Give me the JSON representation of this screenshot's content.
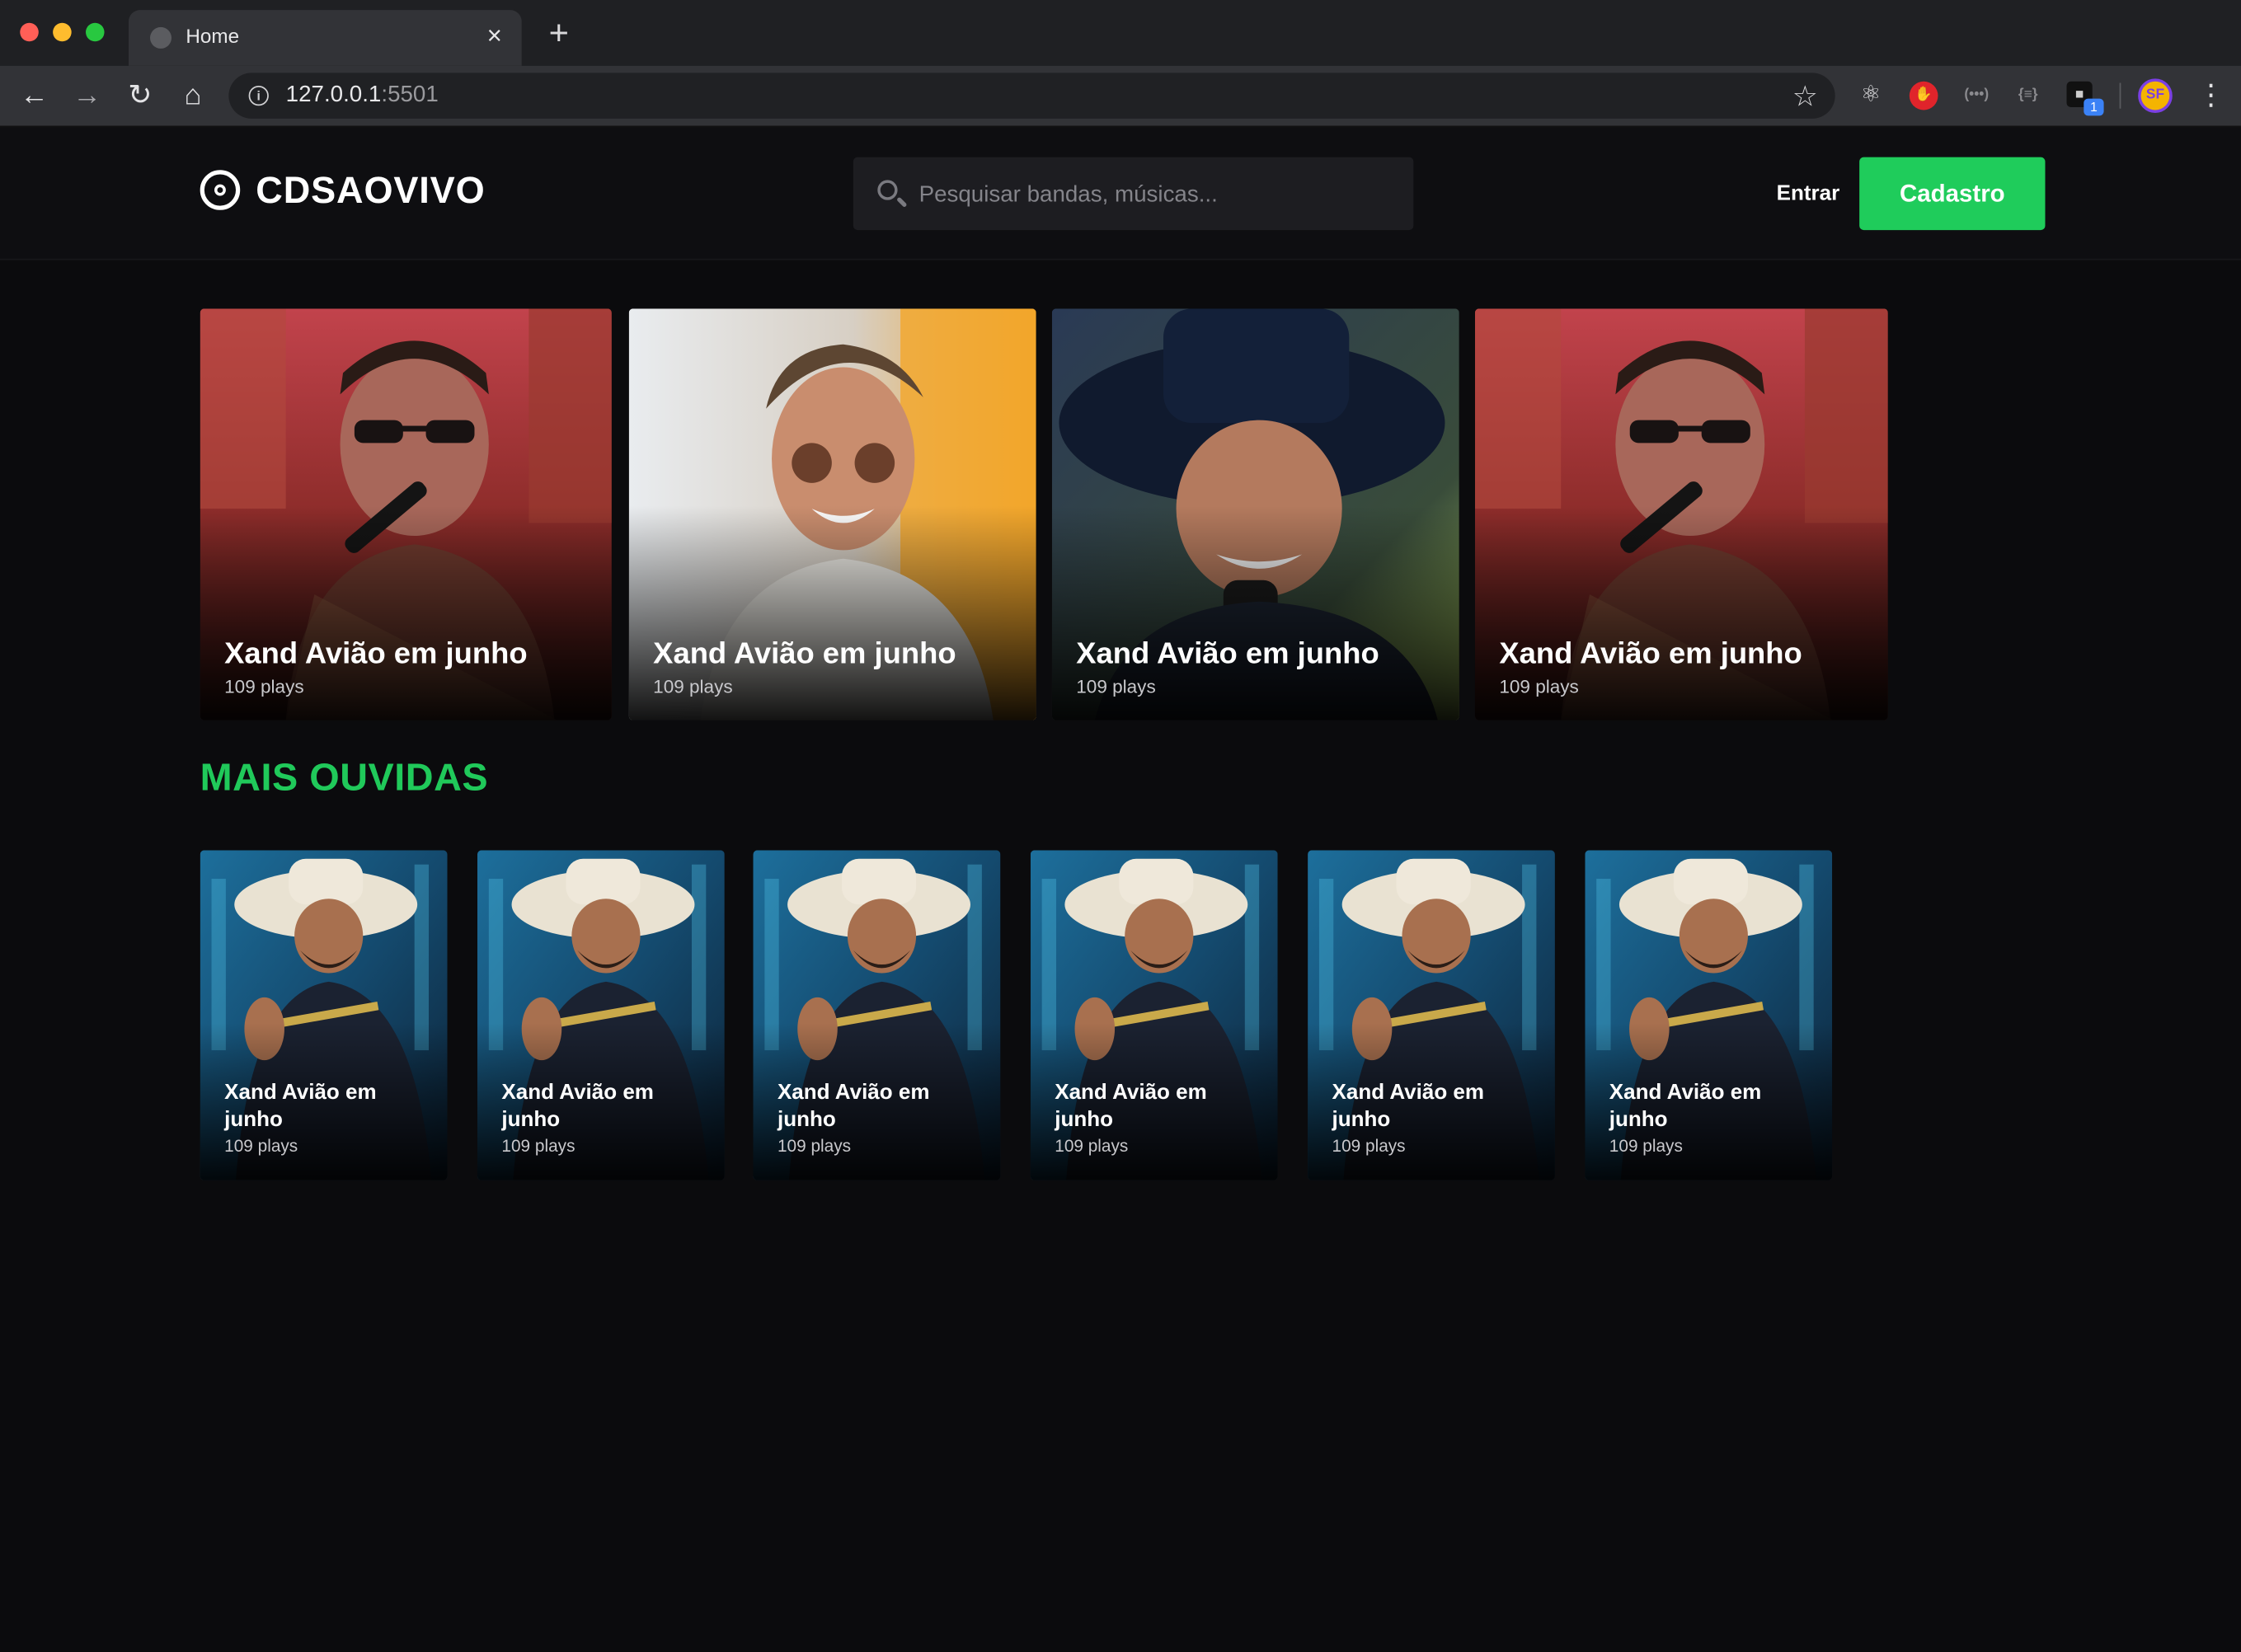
{
  "browser": {
    "tab_title": "Home",
    "close_glyph": "×",
    "new_tab_glyph": "+",
    "url_host": "127.0.0.1",
    "url_port": ":5501",
    "avatar_initials": "SF",
    "extension_badge": "1",
    "icons": [
      "back-icon",
      "forward-icon",
      "reload-icon",
      "home-icon",
      "info-icon",
      "star-icon",
      "react-devtools-icon",
      "adblock-icon",
      "extension-icon",
      "menu-icon"
    ]
  },
  "site": {
    "logo_text": "CDSAOVIVO",
    "search_placeholder": "Pesquisar bandas, músicas...",
    "login_label": "Entrar",
    "signup_label": "Cadastro",
    "accent_color": "#1fcc5b"
  },
  "featured": [
    {
      "title": "Xand Avião em junho",
      "plays": "109 plays"
    },
    {
      "title": "Xand Avião em junho",
      "plays": "109 plays"
    },
    {
      "title": "Xand Avião em junho",
      "plays": "109 plays"
    },
    {
      "title": "Xand Avião em junho",
      "plays": "109 plays"
    }
  ],
  "most_played": {
    "title": "MAIS OUVIDAS",
    "items": [
      {
        "title": "Xand Avião em junho",
        "plays": "109 plays"
      },
      {
        "title": "Xand Avião em junho",
        "plays": "109 plays"
      },
      {
        "title": "Xand Avião em junho",
        "plays": "109 plays"
      },
      {
        "title": "Xand Avião em junho",
        "plays": "109 plays"
      },
      {
        "title": "Xand Avião em junho",
        "plays": "109 plays"
      },
      {
        "title": "Xand Avião em junho",
        "plays": "109 plays"
      }
    ]
  }
}
